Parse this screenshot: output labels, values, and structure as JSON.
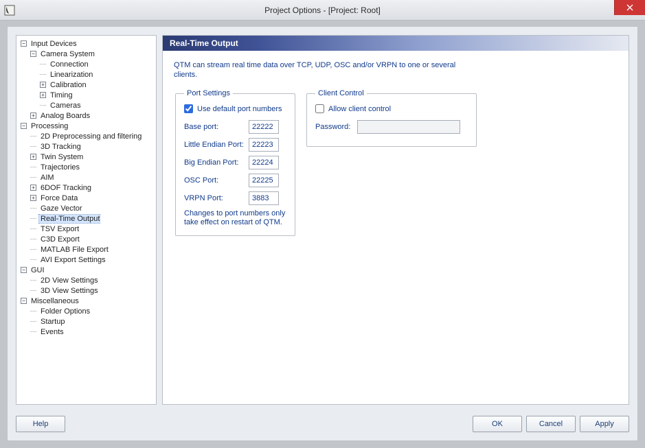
{
  "window": {
    "title": "Project Options - [Project: Root]"
  },
  "tree": {
    "input_devices": "Input Devices",
    "camera_system": "Camera System",
    "connection": "Connection",
    "linearization": "Linearization",
    "calibration": "Calibration",
    "timing": "Timing",
    "cameras": "Cameras",
    "analog_boards": "Analog Boards",
    "processing": "Processing",
    "pp_2d": "2D Preprocessing and filtering",
    "tracking_3d": "3D Tracking",
    "twin": "Twin System",
    "trajectories": "Trajectories",
    "aim": "AIM",
    "six_dof": "6DOF Tracking",
    "force_data": "Force Data",
    "gaze": "Gaze Vector",
    "rto": "Real-Time Output",
    "tsv": "TSV Export",
    "c3d": "C3D Export",
    "matlab": "MATLAB File Export",
    "avi": "AVI Export Settings",
    "gui": "GUI",
    "view2d": "2D View Settings",
    "view3d": "3D View Settings",
    "misc": "Miscellaneous",
    "folder": "Folder Options",
    "startup": "Startup",
    "events": "Events"
  },
  "panel": {
    "title": "Real-Time Output",
    "description": "QTM can stream real time data over TCP, UDP, OSC and/or VRPN to one or several clients.",
    "port_settings_legend": "Port Settings",
    "use_default": "Use default port numbers",
    "base_port_label": "Base port:",
    "base_port_value": "22222",
    "le_port_label": "Little Endian Port:",
    "le_port_value": "22223",
    "be_port_label": "Big Endian Port:",
    "be_port_value": "22224",
    "osc_port_label": "OSC Port:",
    "osc_port_value": "22225",
    "vrpn_port_label": "VRPN Port:",
    "vrpn_port_value": "3883",
    "note": "Changes to port numbers only take effect on restart of QTM.",
    "client_control_legend": "Client Control",
    "allow_client": "Allow client control",
    "password_label": "Password:"
  },
  "buttons": {
    "help": "Help",
    "ok": "OK",
    "cancel": "Cancel",
    "apply": "Apply"
  }
}
